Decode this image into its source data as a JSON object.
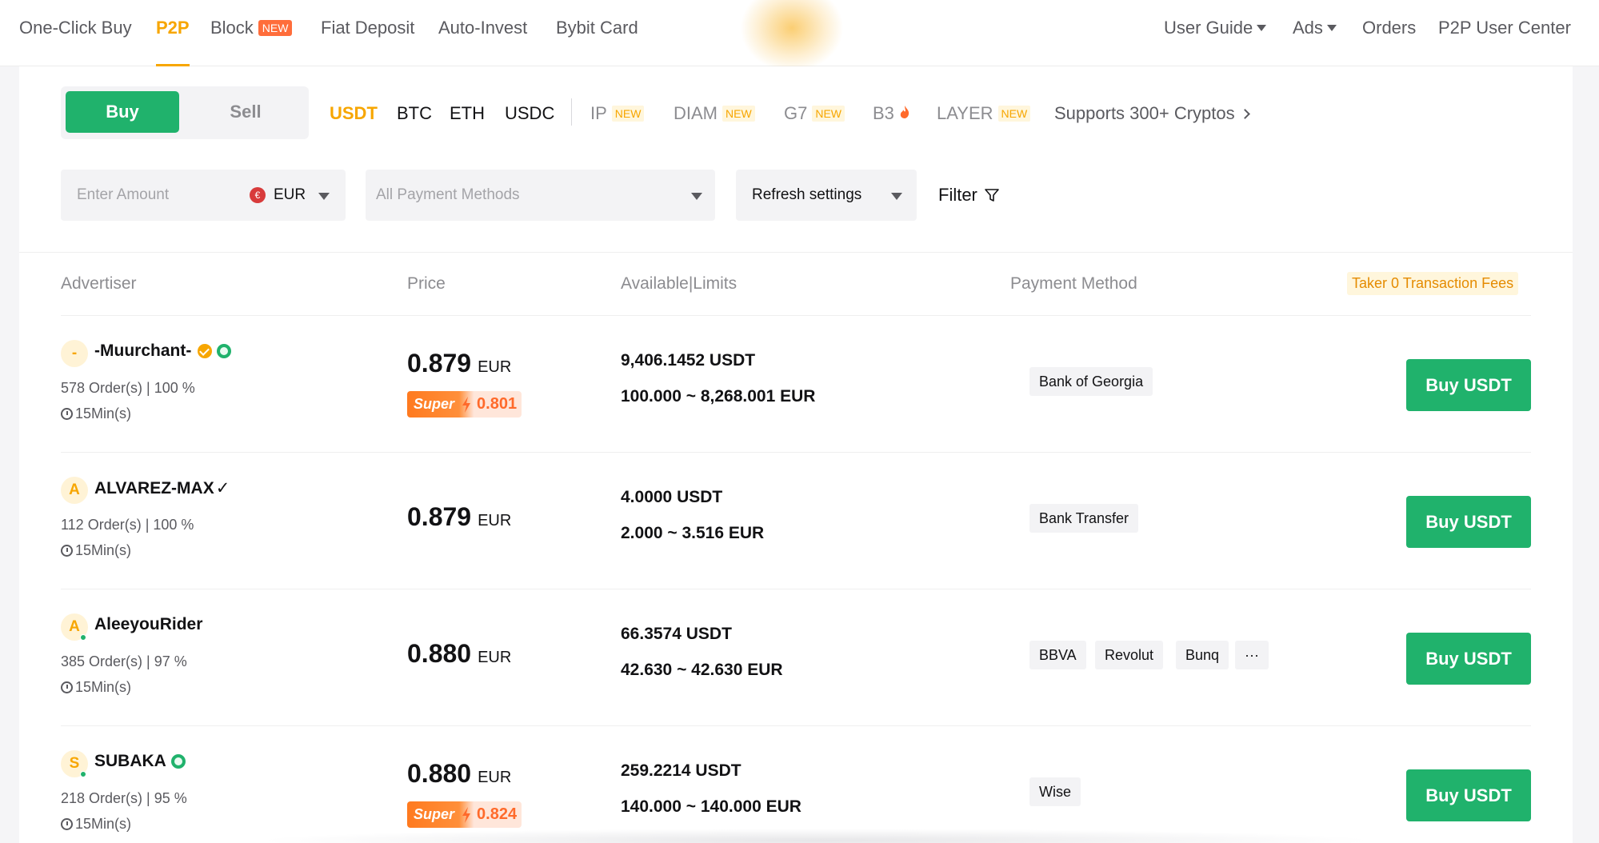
{
  "topnav": {
    "items": [
      {
        "label": "One-Click Buy"
      },
      {
        "label": "P2P"
      },
      {
        "label": "Block",
        "badge": "NEW"
      },
      {
        "label": "Fiat Deposit"
      },
      {
        "label": "Auto-Invest"
      },
      {
        "label": "Bybit Card"
      }
    ],
    "right": [
      {
        "label": "User Guide"
      },
      {
        "label": "Ads"
      },
      {
        "label": "Orders"
      },
      {
        "label": "P2P User Center"
      }
    ],
    "active": "P2P"
  },
  "trade_toggle": {
    "buy": "Buy",
    "sell": "Sell",
    "selected": "Buy"
  },
  "coins": [
    {
      "label": "USDT",
      "tag": ""
    },
    {
      "label": "BTC",
      "tag": ""
    },
    {
      "label": "ETH",
      "tag": ""
    },
    {
      "label": "USDC",
      "tag": ""
    },
    {
      "label": "IP",
      "tag": "NEW"
    },
    {
      "label": "DIAM",
      "tag": "NEW"
    },
    {
      "label": "G7",
      "tag": "NEW"
    },
    {
      "label": "B3",
      "tag": "hot"
    },
    {
      "label": "LAYER",
      "tag": "NEW"
    }
  ],
  "coins_more": "Supports 300+ Cryptos",
  "selected_coin": "USDT",
  "filters": {
    "amount_placeholder": "Enter Amount",
    "currency_symbol": "€",
    "currency": "EUR",
    "payment_placeholder": "All Payment Methods",
    "refresh": "Refresh settings",
    "filter": "Filter"
  },
  "table": {
    "headers": {
      "advertiser": "Advertiser",
      "price": "Price",
      "available": "Available|Limits",
      "payment": "Payment Method"
    },
    "fee_badge": "Taker 0 Transaction Fees",
    "rows": [
      {
        "initial": "-",
        "name": "-Muurchant-",
        "orders": "578 Order(s)   |   100 %",
        "time": "15Min(s)",
        "price": "0.879",
        "currency": "EUR",
        "super_label": "Super",
        "super_price": "0.801",
        "available": "9,406.1452 USDT",
        "limits": "100.000 ~ 8,268.001 EUR",
        "payments": [
          "Bank of Georgia"
        ],
        "button": "Buy USDT"
      },
      {
        "initial": "A",
        "name": "ALVAREZ-MAX",
        "name_suffix": "✓",
        "orders": "112 Order(s)   |   100 %",
        "time": "15Min(s)",
        "price": "0.879",
        "currency": "EUR",
        "available": "4.0000 USDT",
        "limits": "2.000 ~ 3.516 EUR",
        "payments": [
          "Bank Transfer"
        ],
        "button": "Buy USDT"
      },
      {
        "initial": "A",
        "name": "AleeyouRider",
        "orders": "385 Order(s)   |   97 %",
        "time": "15Min(s)",
        "price": "0.880",
        "currency": "EUR",
        "available": "66.3574 USDT",
        "limits": "42.630 ~ 42.630 EUR",
        "payments": [
          "BBVA",
          "Revolut",
          "Bunq",
          "···"
        ],
        "button": "Buy USDT"
      },
      {
        "initial": "S",
        "name": "SUBAKA",
        "orders": "218 Order(s)   |   95 %",
        "time": "15Min(s)",
        "price": "0.880",
        "currency": "EUR",
        "super_label": "Super",
        "super_price": "0.824",
        "available": "259.2214 USDT",
        "limits": "140.000 ~ 140.000 EUR",
        "payments": [
          "Wise"
        ],
        "button": "Buy USDT"
      }
    ]
  },
  "colors": {
    "accent": "#f7a600",
    "buy_green": "#20b26c",
    "new_badge": "#ff6d3b",
    "super_orange": "#ff7a1f"
  }
}
